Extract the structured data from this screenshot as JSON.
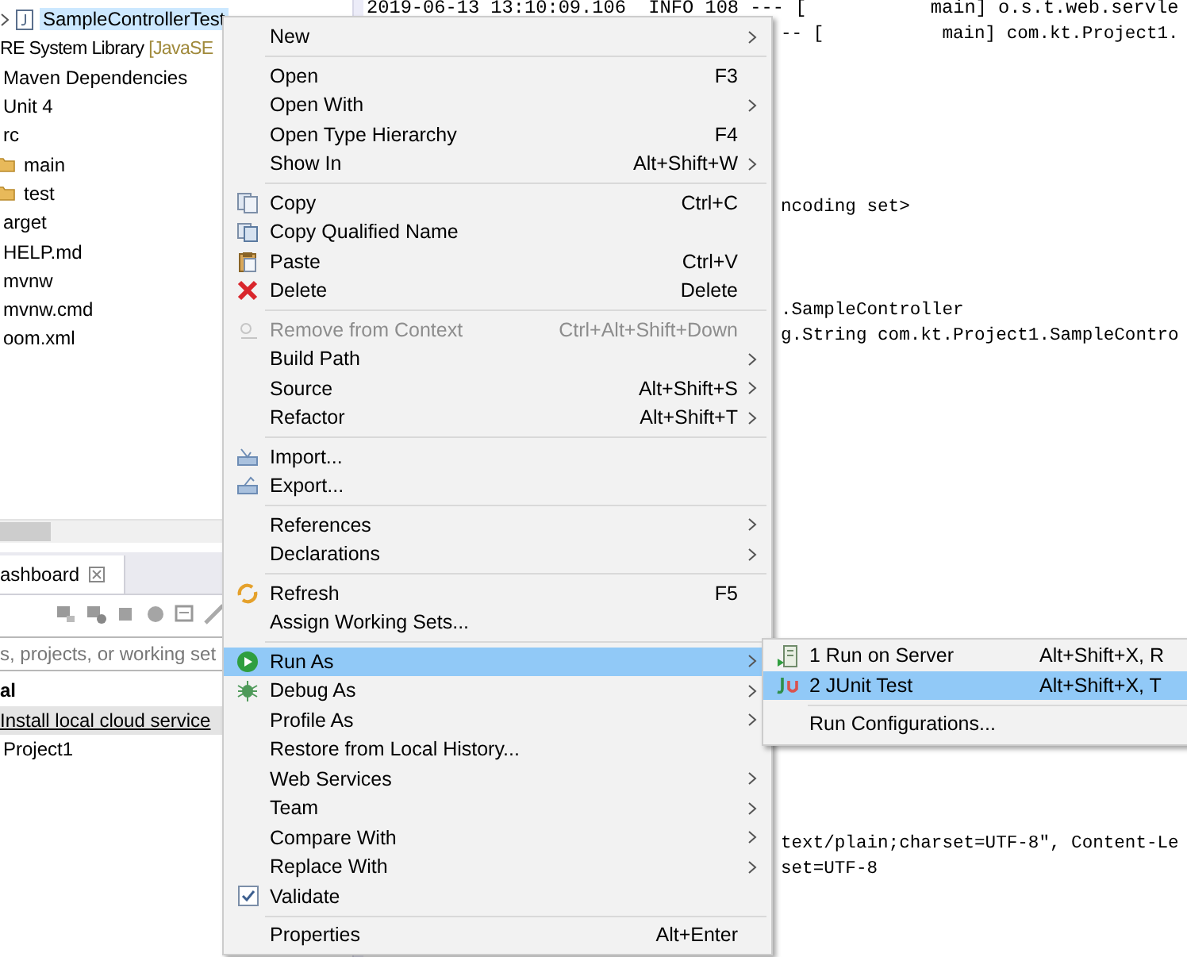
{
  "project_tree": {
    "items": [
      {
        "label": "SampleControllerTest",
        "expanded": false,
        "selected": true
      },
      {
        "label": "RE System Library",
        "decoration": "[JavaSE",
        "selected": false
      },
      {
        "label": "Maven Dependencies",
        "selected": false
      },
      {
        "label": "Unit 4",
        "selected": false
      },
      {
        "label": "rc",
        "selected": false,
        "children": [
          {
            "label": "main",
            "selected": false
          },
          {
            "label": "test",
            "selected": false
          }
        ]
      },
      {
        "label": "arget",
        "selected": false
      },
      {
        "label": "HELP.md",
        "selected": false
      },
      {
        "label": "mvnw",
        "selected": false
      },
      {
        "label": "mvnw.cmd",
        "selected": false
      },
      {
        "label": "oom.xml",
        "selected": false
      }
    ]
  },
  "dashboard": {
    "tab": {
      "label": "ashboard"
    },
    "search": {
      "placeholder": "s, projects, or working set"
    },
    "items": [
      {
        "label": "al",
        "kind": "group",
        "selected": false
      },
      {
        "label": "Install local cloud service",
        "kind": "link",
        "selected": true
      },
      {
        "label": "Project1",
        "kind": "project",
        "selected": false
      }
    ]
  },
  "console": {
    "lines": [
      "2019-06-13 13:10:09.106  INFO 108 --- [           main] o.s.t.web.servle",
      "-- [           main] com.kt.Project1.",
      "ncoding set>",
      ".SampleController",
      "g.String com.kt.Project1.SampleContro",
      "text/plain;charset=UTF-8\", Content-Le",
      "set=UTF-8"
    ]
  },
  "context_menu": {
    "sections": [
      {
        "items": [
          {
            "label": "New",
            "submenu": true,
            "selected": false,
            "disabled": false,
            "checked": false
          }
        ]
      },
      {
        "items": [
          {
            "label": "Open",
            "shortcut": "F3",
            "submenu": false,
            "selected": false,
            "disabled": false,
            "checked": false
          },
          {
            "label": "Open With",
            "submenu": true,
            "selected": false,
            "disabled": false,
            "checked": false
          },
          {
            "label": "Open Type Hierarchy",
            "shortcut": "F4",
            "submenu": false,
            "selected": false,
            "disabled": false,
            "checked": false
          },
          {
            "label": "Show In",
            "shortcut": "Alt+Shift+W",
            "submenu": true,
            "selected": false,
            "disabled": false,
            "checked": false
          }
        ]
      },
      {
        "items": [
          {
            "label": "Copy",
            "shortcut": "Ctrl+C",
            "submenu": false,
            "selected": false,
            "disabled": false,
            "checked": false
          },
          {
            "label": "Copy Qualified Name",
            "submenu": false,
            "selected": false,
            "disabled": false,
            "checked": false
          },
          {
            "label": "Paste",
            "shortcut": "Ctrl+V",
            "submenu": false,
            "selected": false,
            "disabled": false,
            "checked": false
          },
          {
            "label": "Delete",
            "shortcut": "Delete",
            "submenu": false,
            "selected": false,
            "disabled": false,
            "checked": false
          }
        ]
      },
      {
        "items": [
          {
            "label": "Remove from Context",
            "shortcut": "Ctrl+Alt+Shift+Down",
            "submenu": false,
            "selected": false,
            "disabled": true,
            "checked": false
          },
          {
            "label": "Build Path",
            "submenu": true,
            "selected": false,
            "disabled": false,
            "checked": false
          },
          {
            "label": "Source",
            "shortcut": "Alt+Shift+S",
            "submenu": true,
            "selected": false,
            "disabled": false,
            "checked": false
          },
          {
            "label": "Refactor",
            "shortcut": "Alt+Shift+T",
            "submenu": true,
            "selected": false,
            "disabled": false,
            "checked": false
          }
        ]
      },
      {
        "items": [
          {
            "label": "Import...",
            "submenu": false,
            "selected": false,
            "disabled": false,
            "checked": false
          },
          {
            "label": "Export...",
            "submenu": false,
            "selected": false,
            "disabled": false,
            "checked": false
          }
        ]
      },
      {
        "items": [
          {
            "label": "References",
            "submenu": true,
            "selected": false,
            "disabled": false,
            "checked": false
          },
          {
            "label": "Declarations",
            "submenu": true,
            "selected": false,
            "disabled": false,
            "checked": false
          }
        ]
      },
      {
        "items": [
          {
            "label": "Refresh",
            "shortcut": "F5",
            "submenu": false,
            "selected": false,
            "disabled": false,
            "checked": false
          },
          {
            "label": "Assign Working Sets...",
            "submenu": false,
            "selected": false,
            "disabled": false,
            "checked": false
          }
        ]
      },
      {
        "items": [
          {
            "label": "Run As",
            "submenu": true,
            "selected": true,
            "disabled": false,
            "checked": false
          },
          {
            "label": "Debug As",
            "submenu": true,
            "selected": false,
            "disabled": false,
            "checked": false
          },
          {
            "label": "Profile As",
            "submenu": true,
            "selected": false,
            "disabled": false,
            "checked": false
          },
          {
            "label": "Restore from Local History...",
            "submenu": false,
            "selected": false,
            "disabled": false,
            "checked": false
          },
          {
            "label": "Web Services",
            "submenu": true,
            "selected": false,
            "disabled": false,
            "checked": false
          },
          {
            "label": "Team",
            "submenu": true,
            "selected": false,
            "disabled": false,
            "checked": false
          },
          {
            "label": "Compare With",
            "submenu": true,
            "selected": false,
            "disabled": false,
            "checked": false
          },
          {
            "label": "Replace With",
            "submenu": true,
            "selected": false,
            "disabled": false,
            "checked": false
          },
          {
            "label": "Validate",
            "submenu": false,
            "selected": false,
            "disabled": false,
            "checked": true
          }
        ]
      },
      {
        "items": [
          {
            "label": "Properties",
            "shortcut": "Alt+Enter",
            "submenu": false,
            "selected": false,
            "disabled": false,
            "checked": false
          }
        ]
      }
    ]
  },
  "run_as_submenu": {
    "sections": [
      {
        "items": [
          {
            "label": "1 Run on Server",
            "shortcut": "Alt+Shift+X, R",
            "selected": false
          },
          {
            "label": "2 JUnit Test",
            "shortcut": "Alt+Shift+X, T",
            "selected": true
          }
        ]
      },
      {
        "items": [
          {
            "label": "Run Configurations...",
            "selected": false
          }
        ]
      }
    ]
  }
}
